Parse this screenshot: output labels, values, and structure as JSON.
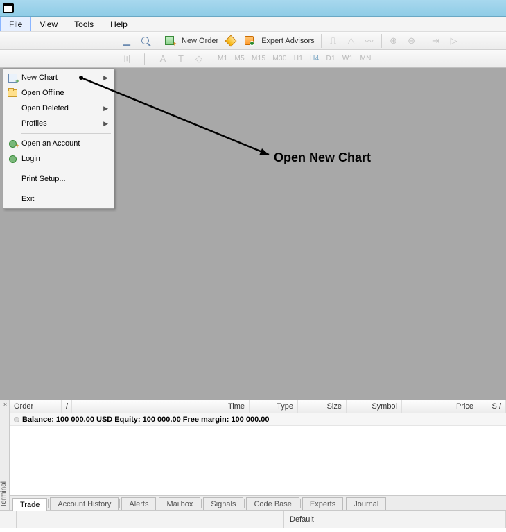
{
  "titlebar": {
    "text": " "
  },
  "menubar": {
    "items": [
      "File",
      "View",
      "Tools",
      "Help"
    ],
    "activeIndex": 0
  },
  "toolbar1": {
    "newOrderLabel": "New Order",
    "expertAdvisorsLabel": "Expert Advisors"
  },
  "toolbar2": {
    "timeframes": [
      "M1",
      "M5",
      "M15",
      "M30",
      "H1",
      "H4",
      "D1",
      "W1",
      "MN"
    ],
    "activeTimeframe": "H4"
  },
  "fileMenu": {
    "items": [
      {
        "label": "New Chart",
        "icon": "new-chart",
        "submenu": true
      },
      {
        "label": "Open Offline",
        "icon": "folder"
      },
      {
        "label": "Open Deleted",
        "submenu": true
      },
      {
        "label": "Profiles",
        "submenu": true
      },
      {
        "sep": true
      },
      {
        "label": "Open an Account",
        "icon": "user-add"
      },
      {
        "label": "Login",
        "icon": "user-login"
      },
      {
        "sep": true
      },
      {
        "label": "Print Setup..."
      },
      {
        "sep": true
      },
      {
        "label": "Exit"
      }
    ]
  },
  "annotation": {
    "text": "Open New Chart"
  },
  "terminal": {
    "sideLabel": "Terminal",
    "columns": [
      "Order",
      "/",
      "Time",
      "Type",
      "Size",
      "Symbol",
      "Price",
      "S /"
    ],
    "balanceRow": "Balance: 100 000.00 USD  Equity: 100 000.00  Free margin: 100 000.00",
    "tabs": [
      "Trade",
      "Account History",
      "Alerts",
      "Mailbox",
      "Signals",
      "Code Base",
      "Experts",
      "Journal"
    ],
    "activeTab": "Trade"
  },
  "statusbar": {
    "helpText": "",
    "profile": "Default"
  }
}
